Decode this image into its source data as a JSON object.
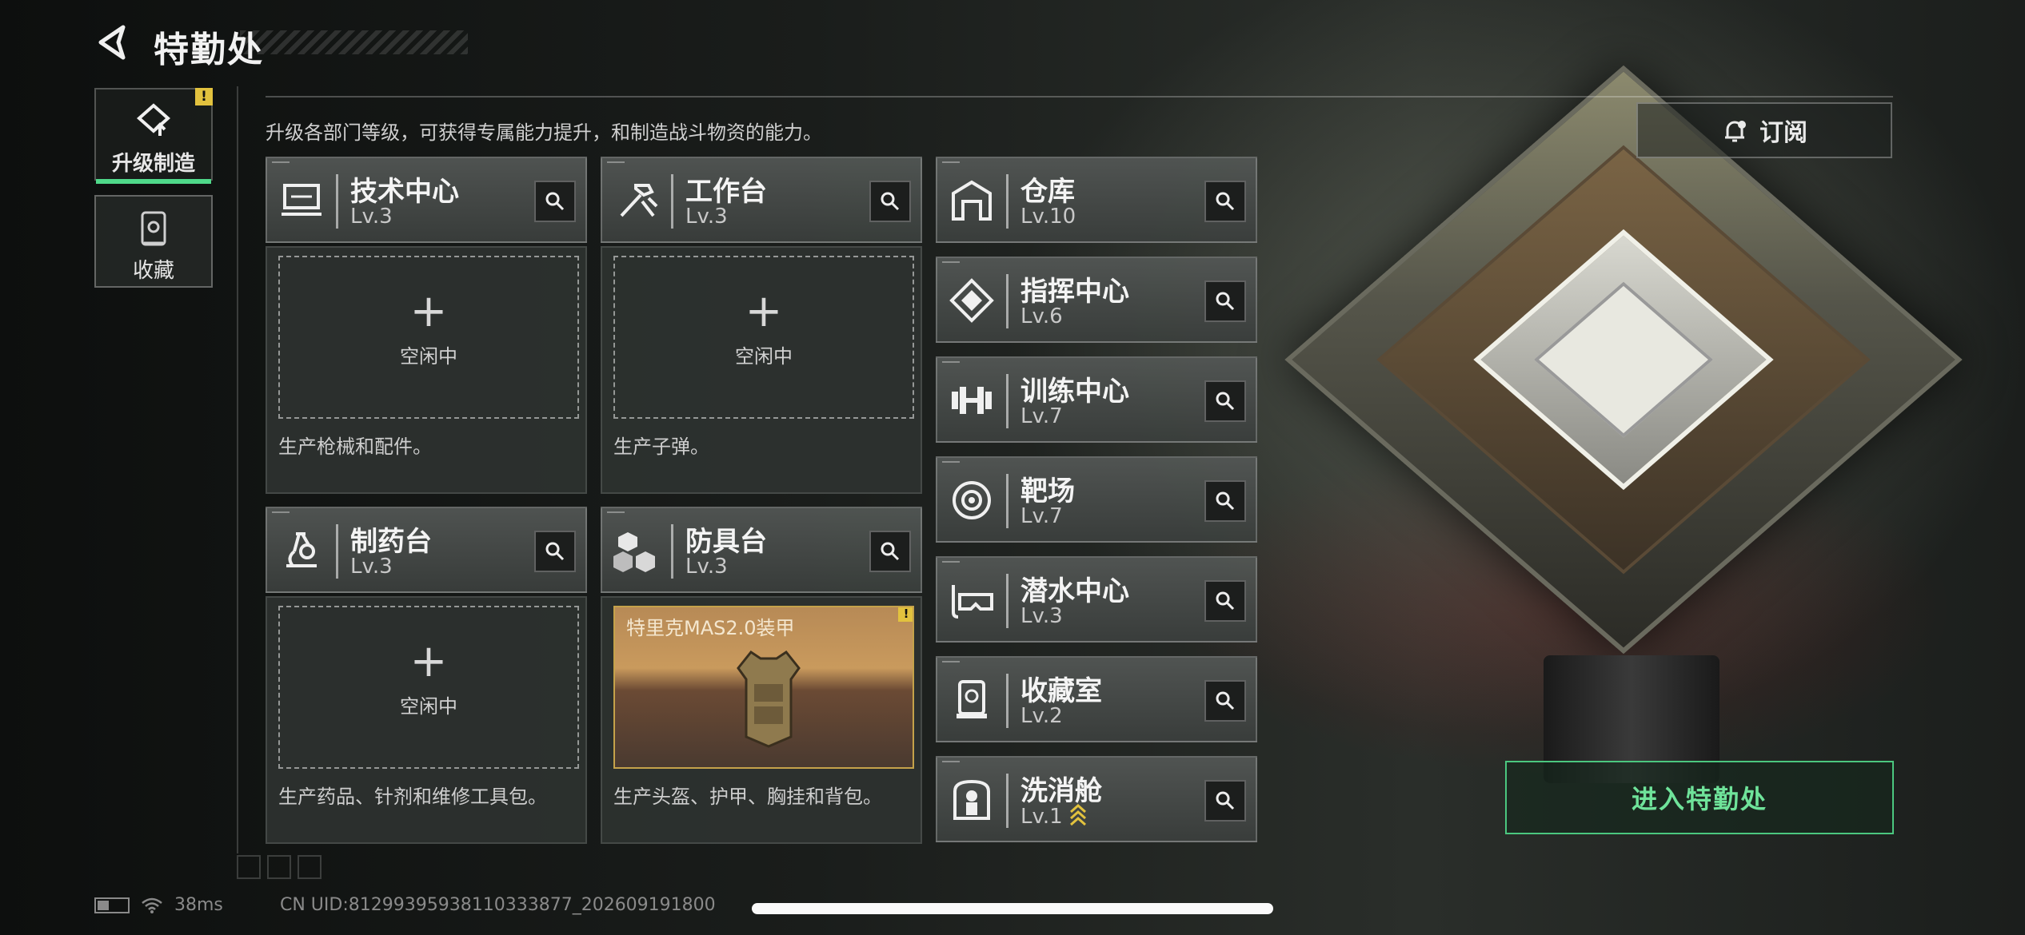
{
  "header": {
    "title": "特勤处"
  },
  "tabs": [
    {
      "label": "升级制造",
      "active": true,
      "alert": "!"
    },
    {
      "label": "收藏",
      "active": false
    }
  ],
  "description": "升级各部门等级，可获得专属能力提升，和制造战斗物资的能力。",
  "subscribe_label": "订阅",
  "production": [
    {
      "name": "技术中心",
      "level": "Lv.3",
      "icon": "tech-center-icon",
      "slot_status": "空闲中",
      "desc": "生产枪械和配件。"
    },
    {
      "name": "工作台",
      "level": "Lv.3",
      "icon": "workbench-icon",
      "slot_status": "空闲中",
      "desc": "生产子弹。"
    },
    {
      "name": "制药台",
      "level": "Lv.3",
      "icon": "pharmacy-icon",
      "slot_status": "空闲中",
      "desc": "生产药品、针剂和维修工具包。"
    },
    {
      "name": "防具台",
      "level": "Lv.3",
      "icon": "armor-bench-icon",
      "item_name": "特里克MAS2.0装甲",
      "item_alert": "!",
      "desc": "生产头盔、护甲、胸挂和背包。"
    }
  ],
  "facilities": [
    {
      "name": "仓库",
      "level": "Lv.10",
      "icon": "warehouse-icon"
    },
    {
      "name": "指挥中心",
      "level": "Lv.6",
      "icon": "command-center-icon"
    },
    {
      "name": "训练中心",
      "level": "Lv.7",
      "icon": "dumbbell-icon"
    },
    {
      "name": "靶场",
      "level": "Lv.7",
      "icon": "target-icon"
    },
    {
      "name": "潜水中心",
      "level": "Lv.3",
      "icon": "diving-mask-icon"
    },
    {
      "name": "收藏室",
      "level": "Lv.2",
      "icon": "collection-room-icon"
    },
    {
      "name": "洗消舱",
      "level": "Lv.1",
      "icon": "decon-chamber-icon",
      "upgradable": true
    }
  ],
  "enter_label": "进入特勤处",
  "footer": {
    "ping": "38ms",
    "uid": "CN UID:81299395938110333877_202609191800"
  },
  "colors": {
    "accent_green": "#4fd98a",
    "alert_yellow": "#e2c23e"
  }
}
